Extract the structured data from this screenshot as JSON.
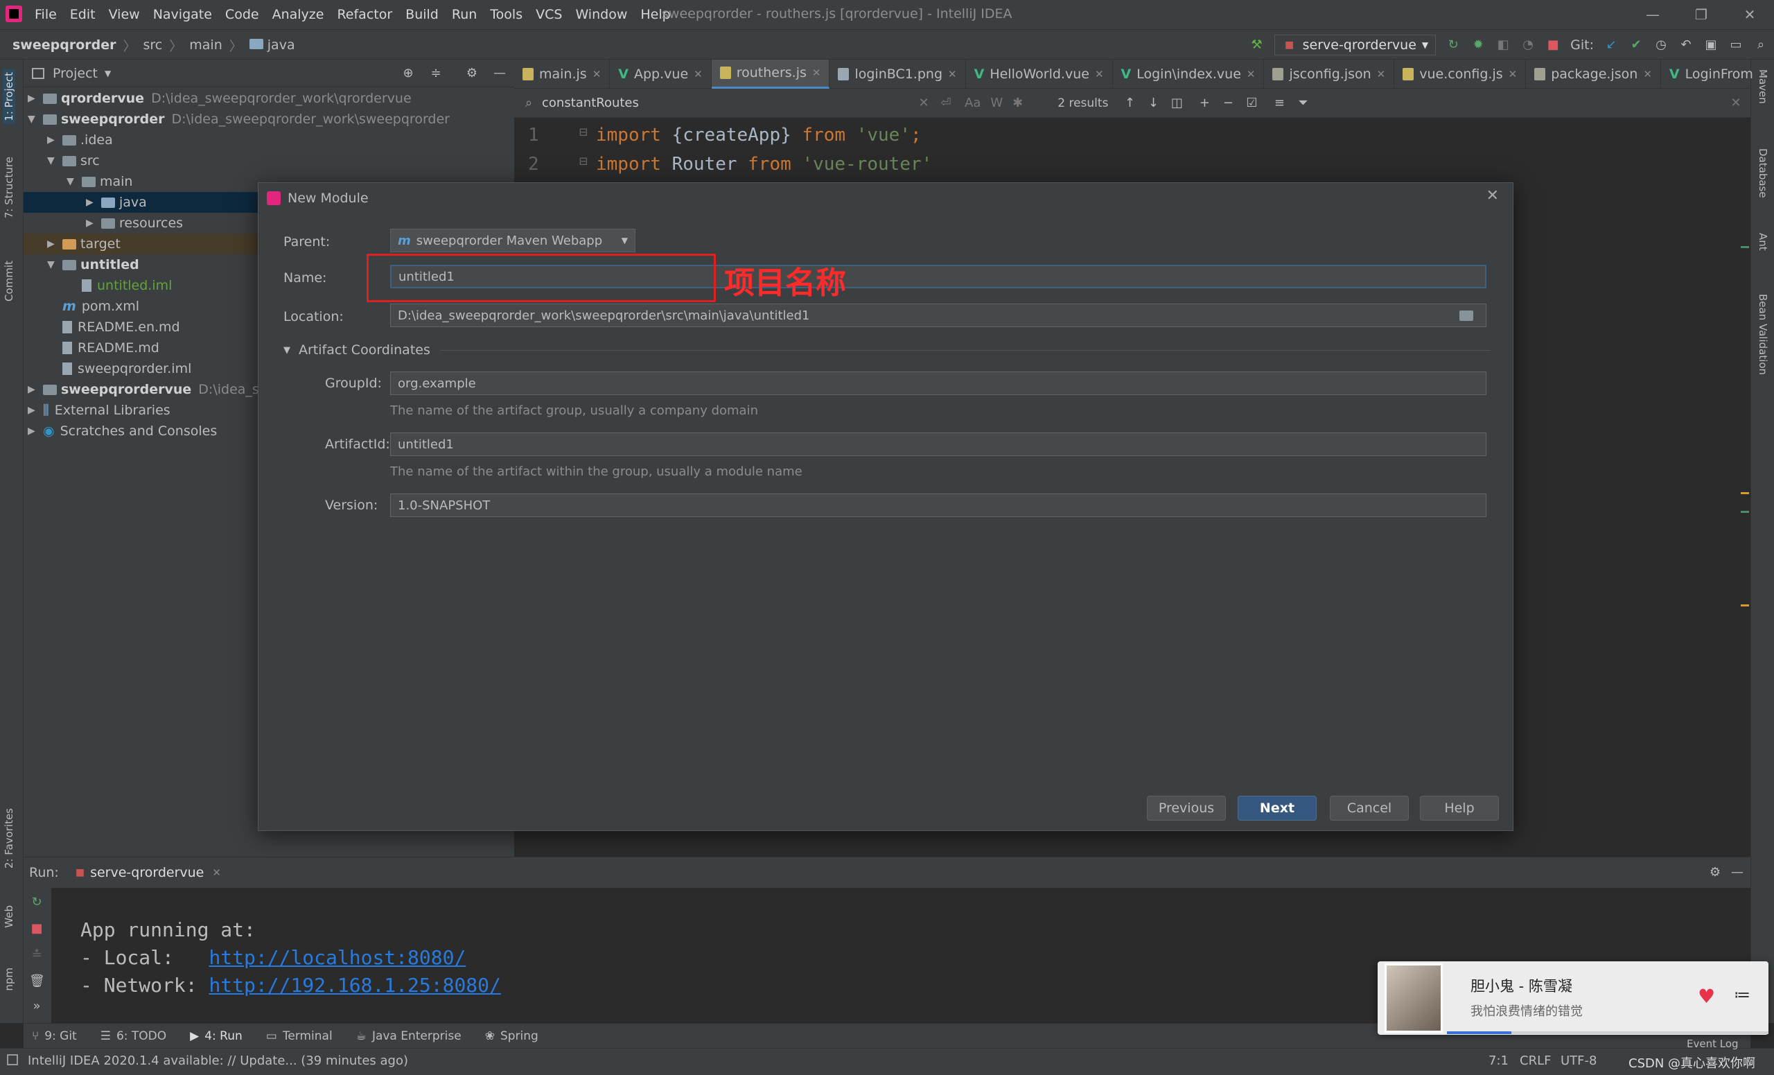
{
  "app": {
    "window_title": "sweepqrorder - routhers.js [qrordervue] - IntelliJ IDEA",
    "menu": [
      "File",
      "Edit",
      "View",
      "Navigate",
      "Code",
      "Analyze",
      "Refactor",
      "Build",
      "Run",
      "Tools",
      "VCS",
      "Window",
      "Help"
    ],
    "win_controls": [
      "—",
      "❐",
      "✕"
    ]
  },
  "breadcrumb": [
    "sweepqrorder",
    "src",
    "main",
    "java"
  ],
  "toolbar": {
    "run_config": "serve-qrordervue",
    "git_label": "Git:"
  },
  "left_strip": [
    "1: Project",
    "7: Structure",
    "Commit",
    "2: Favorites",
    "Web",
    "npm"
  ],
  "right_strip": [
    "Maven",
    "Database",
    "Ant",
    "Bean Validation"
  ],
  "project": {
    "title": "Project",
    "tree": [
      {
        "label": "qrordervue",
        "path": "D:\\idea_sweepqrorder_work\\qrordervue",
        "bold": true,
        "depth": 0,
        "arrow": "▶",
        "icon": "dark"
      },
      {
        "label": "sweepqrorder",
        "path": "D:\\idea_sweepqrorder_work\\sweepqrorder",
        "bold": true,
        "depth": 0,
        "arrow": "▼",
        "icon": "dark"
      },
      {
        "label": ".idea",
        "depth": 1,
        "arrow": "▶",
        "icon": "dark"
      },
      {
        "label": "src",
        "depth": 1,
        "arrow": "▼",
        "icon": "dark"
      },
      {
        "label": "main",
        "depth": 2,
        "arrow": "▼",
        "icon": "dark"
      },
      {
        "label": "java",
        "depth": 3,
        "arrow": "▶",
        "icon": "blue",
        "selected": true
      },
      {
        "label": "resources",
        "depth": 3,
        "arrow": "▶",
        "icon": "dark"
      },
      {
        "label": "target",
        "depth": 1,
        "arrow": "▶",
        "icon": "orange",
        "excluded": true
      },
      {
        "label": "untitled",
        "depth": 1,
        "arrow": "▼",
        "icon": "dark",
        "bold": true
      },
      {
        "label": "untitled.iml",
        "depth": 2,
        "arrow": "",
        "icon": "file",
        "green": true
      },
      {
        "label": "pom.xml",
        "depth": 1,
        "arrow": "",
        "icon": "m"
      },
      {
        "label": "README.en.md",
        "depth": 1,
        "arrow": "",
        "icon": "file"
      },
      {
        "label": "README.md",
        "depth": 1,
        "arrow": "",
        "icon": "file"
      },
      {
        "label": "sweepqrorder.iml",
        "depth": 1,
        "arrow": "",
        "icon": "file"
      },
      {
        "label": "sweepqrordervue",
        "path": "D:\\idea_swee",
        "bold": true,
        "depth": 0,
        "arrow": "▶",
        "icon": "dark"
      },
      {
        "label": "External Libraries",
        "depth": 0,
        "arrow": "▶",
        "icon": "lib"
      },
      {
        "label": "Scratches and Consoles",
        "depth": 0,
        "arrow": "▶",
        "icon": "scratch"
      }
    ]
  },
  "editor": {
    "tabs": [
      {
        "label": "main.js",
        "type": "js"
      },
      {
        "label": "App.vue",
        "type": "vue"
      },
      {
        "label": "routhers.js",
        "type": "js",
        "active": true
      },
      {
        "label": "loginBC1.png",
        "type": "img"
      },
      {
        "label": "HelloWorld.vue",
        "type": "vue"
      },
      {
        "label": "Login\\index.vue",
        "type": "vue"
      },
      {
        "label": "jsconfig.json",
        "type": "json"
      },
      {
        "label": "vue.config.js",
        "type": "js"
      },
      {
        "label": "package.json",
        "type": "json"
      },
      {
        "label": "LoginFrom",
        "type": "vue"
      }
    ],
    "find": {
      "query": "constantRoutes",
      "results": "2 results",
      "aa": "Aa",
      "w": "W"
    },
    "lines": [
      {
        "n": "1",
        "tokens": [
          [
            "kw",
            "import "
          ],
          [
            "plain",
            "{createApp} "
          ],
          [
            "kw",
            "from "
          ],
          [
            "str",
            "'vue'"
          ],
          [
            "kw",
            ";"
          ]
        ]
      },
      {
        "n": "2",
        "tokens": [
          [
            "kw",
            "import "
          ],
          [
            "plain",
            "Router "
          ],
          [
            "kw",
            "from "
          ],
          [
            "str",
            "'vue-router'"
          ]
        ]
      }
    ]
  },
  "dialog": {
    "title": "New Module",
    "parent_label": "Parent:",
    "parent_value": "sweepqrorder Maven Webapp",
    "name_label": "Name:",
    "name_value": "untitled1",
    "annotation": "项目名称",
    "location_label": "Location:",
    "location_value": "D:\\idea_sweepqrorder_work\\sweepqrorder\\src\\main\\java\\untitled1",
    "section": "Artifact Coordinates",
    "groupid_label": "GroupId:",
    "groupid_value": "org.example",
    "groupid_hint": "The name of the artifact group, usually a company domain",
    "artifactid_label": "ArtifactId:",
    "artifactid_value": "untitled1",
    "artifactid_hint": "The name of the artifact within the group, usually a module name",
    "version_label": "Version:",
    "version_value": "1.0-SNAPSHOT",
    "buttons": {
      "previous": "Previous",
      "next": "Next",
      "cancel": "Cancel",
      "help": "Help"
    }
  },
  "run": {
    "label": "Run:",
    "tab": "serve-qrordervue",
    "console": [
      "App running at:",
      "- Local:   ",
      "- Network: "
    ],
    "local_url": "http://localhost:8080/",
    "network_url": "http://192.168.1.25:8080/"
  },
  "bottom_tabs": [
    "9: Git",
    "6: TODO",
    "4: Run",
    "Terminal",
    "Java Enterprise",
    "Spring"
  ],
  "status": {
    "message": "IntelliJ IDEA 2020.1.4 available: // Update... (39 minutes ago)",
    "position": "7:1",
    "line_sep": "CRLF",
    "encoding": "UTF-8",
    "event_log": "Event Log",
    "watermark": "CSDN @真心喜欢你啊"
  },
  "music": {
    "title": "胆小鬼 - 陈雪凝",
    "subtitle": "我怕浪费情绪的错觉",
    "progress": 0.2
  },
  "colors": {
    "accent": "#4a88c7",
    "annotation": "#ff2a2a",
    "link": "#287bde"
  }
}
